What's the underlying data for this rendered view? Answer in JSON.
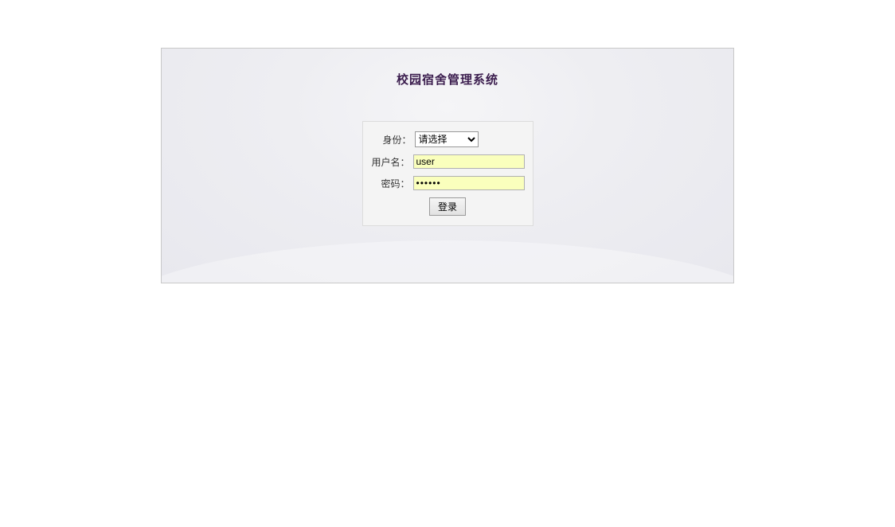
{
  "title": "校园宿舍管理系统",
  "form": {
    "role_label": "身份：",
    "role_selected": "请选择",
    "username_label": "用户名：",
    "username_value": "user",
    "password_label": "密码：",
    "password_value": "••••••",
    "submit_label": "登录"
  }
}
